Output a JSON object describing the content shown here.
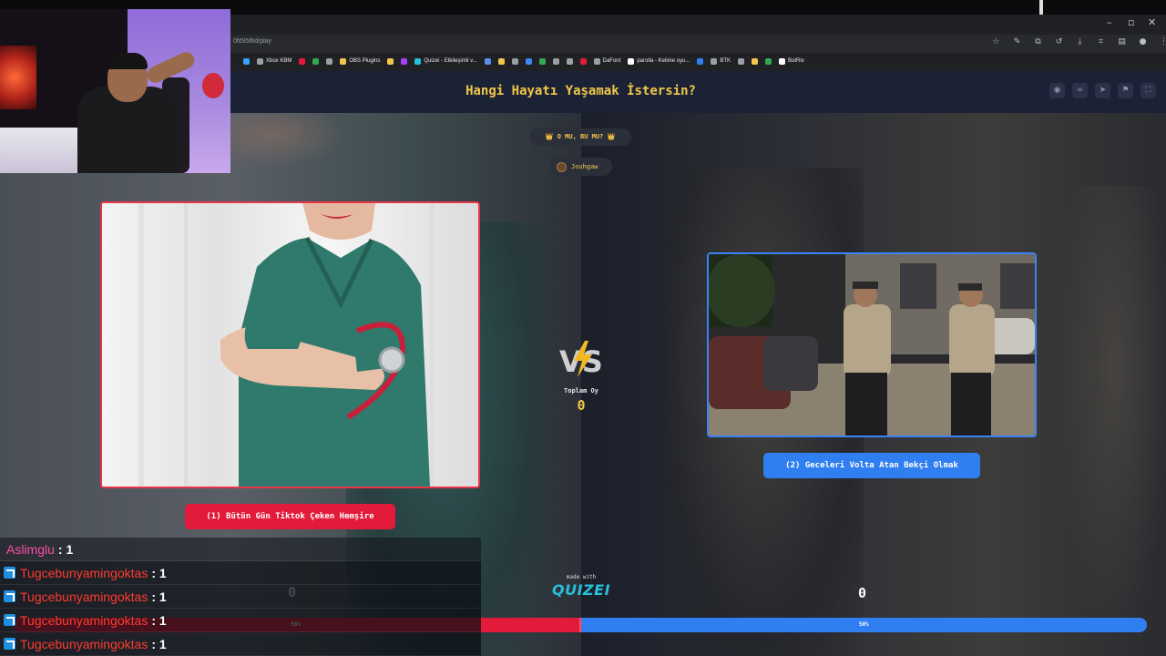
{
  "browser": {
    "url_fragment": "0fd35f6d/play",
    "window_controls": [
      "–",
      "▫",
      "✕"
    ],
    "bookmarks": [
      {
        "label": "",
        "color": "#3aa0ff"
      },
      {
        "label": "Xbox KBM",
        "color": "#9aa0a6"
      },
      {
        "label": "",
        "color": "#e31b3b"
      },
      {
        "label": "",
        "color": "#34a853"
      },
      {
        "label": "",
        "color": "#9aa0a6"
      },
      {
        "label": "OBS Plugins",
        "color": "#f2c84b"
      },
      {
        "label": "",
        "color": "#f2c84b"
      },
      {
        "label": "",
        "color": "#a142f4"
      },
      {
        "label": "Quizei - Etkileşimli v...",
        "color": "#27c0d9"
      },
      {
        "label": "",
        "color": "#5b8def"
      },
      {
        "label": "",
        "color": "#f2c84b"
      },
      {
        "label": "",
        "color": "#9aa0a6"
      },
      {
        "label": "",
        "color": "#4285f4"
      },
      {
        "label": "",
        "color": "#34a853"
      },
      {
        "label": "",
        "color": "#9aa0a6"
      },
      {
        "label": "",
        "color": "#9aa0a6"
      },
      {
        "label": "",
        "color": "#e31b3b"
      },
      {
        "label": "DaFont",
        "color": "#9aa0a6"
      },
      {
        "label": "parolla - Kelime oyu...",
        "color": "#ffffff"
      },
      {
        "label": "",
        "color": "#2f7ff0"
      },
      {
        "label": "BTK",
        "color": "#9aa0a6"
      },
      {
        "label": "",
        "color": "#9aa0a6"
      },
      {
        "label": "",
        "color": "#f2c84b"
      },
      {
        "label": "",
        "color": "#34a853"
      },
      {
        "label": "BotRix",
        "color": "#ffffff"
      }
    ]
  },
  "header": {
    "title": "Hangi Hayatı Yaşamak İstersin?",
    "icons": [
      "eye-icon",
      "link-icon",
      "send-icon",
      "flag-icon",
      "fullscreen-icon"
    ]
  },
  "center": {
    "mode_badge": "👑 O MU, BU MU? 👑",
    "username": "Jouhgaw",
    "vs_text": "VS",
    "total_label": "Toplam Oy",
    "total_value": "0",
    "made_with": "made with",
    "brand": "QUIZEI"
  },
  "options": {
    "left": {
      "label": "(1) Bütün Gün Tiktok Çeken Hemşire",
      "score": "0",
      "percent_label": "50%",
      "percent": 50,
      "color": "#e31b3b"
    },
    "right": {
      "label": "(2) Geceleri Volta Atan Bekçi Olmak",
      "score": "0",
      "percent_label": "50%",
      "percent": 50,
      "color": "#2f7ff0"
    }
  },
  "chat": [
    {
      "user": "Aslimglu",
      "value": ": 1",
      "color": "#ff4fa8",
      "icon": false
    },
    {
      "user": "Tugcebunyamingoktas",
      "value": ": 1",
      "color": "#ff3b2f",
      "icon": true
    },
    {
      "user": "Tugcebunyamingoktas",
      "value": ": 1",
      "color": "#ff3b2f",
      "icon": true
    },
    {
      "user": "Tugcebunyamingoktas",
      "value": ": 1",
      "color": "#ff3b2f",
      "icon": true
    },
    {
      "user": "Tugcebunyamingoktas",
      "value": ": 1",
      "color": "#ff3b2f",
      "icon": true
    }
  ]
}
